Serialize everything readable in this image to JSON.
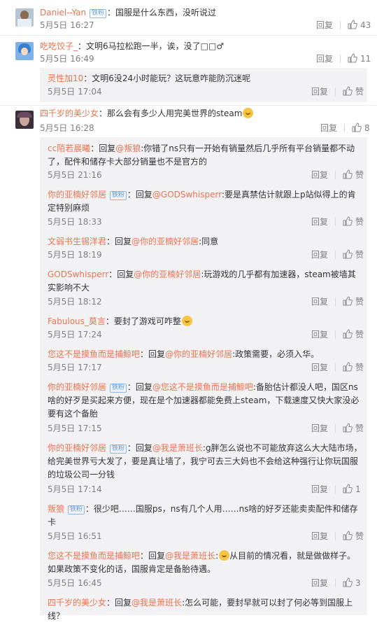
{
  "labels": {
    "reply": "回复",
    "like": "赞",
    "reply_prefix": "回复"
  },
  "top_comments": [
    {
      "user": "Daniel--Yan",
      "badge": "铁粉",
      "text": "：国服是什么东西，没听说过",
      "date": "5月5日 16:27",
      "likes": "43"
    },
    {
      "user": "吃吃饺子_",
      "text": "：文明6马拉松跑一半，诶，没了□□♂",
      "date": "5月5日 16:49",
      "likes": "11"
    },
    {
      "user": "四千岁的美少女",
      "text": "：那么会有多少人用完美世界的steam",
      "date": "5月5日 16:28",
      "likes": "8"
    }
  ],
  "sub_replies": [
    {
      "user": "灵性加10",
      "text": "：文明6没24小时能玩？这玩意咋能防沉迷呢",
      "date": "5月5日 17:04"
    },
    {
      "user": "cc陌若晨曦",
      "mention": "@叛狼",
      "text": ":你错了ns只有一开始有销量然后几乎所有平台销量都不动了，配件和储存卡大部分销量也不是官方的",
      "date": "5月5日 21:16"
    },
    {
      "user": "你的亚楠好邻居",
      "badge": "铁粉",
      "mention": "@GODSwhisperr",
      "text": ":要是真禁估计就跟上p站似得上的肯定特别麻烦",
      "date": "5月5日 18:33"
    },
    {
      "user": "文弱书生锡洋君",
      "mention": "@你的亚楠好邻居",
      "text": ":同意",
      "date": "5月5日 18:19"
    },
    {
      "user": "GODSwhisperr",
      "mention": "@你的亚楠好邻居",
      "text": ":玩游戏的几乎都有加速器，steam被墙其实影响不大",
      "date": "5月5日 18:12"
    },
    {
      "user": "Fabulous_莫言",
      "text": "：要封了游戏可咋整",
      "date": "5月5日 17:24"
    },
    {
      "user": "您这不是摸鱼而是捕鲸吧",
      "mention": "@你的亚楠好邻居",
      "text": ":政策需要，必须入华。",
      "date": "5月5日 17:17"
    },
    {
      "user": "你的亚楠好邻居",
      "badge": "铁粉",
      "mention": "@您这不是摸鱼而是捕鲸吧",
      "text": ":备胎估计都没人吧，国区ns啥的好歹是买起来方便，现在是个加速器都能免费上steam，下载速度又快大家没必要有这个备胎",
      "date": "5月5日 17:15"
    },
    {
      "user": "你的亚楠好邻居",
      "badge": "铁粉",
      "mention": "@我是萧班长",
      "text": ":g胖怎么说也不可能放弃这么大大陆市场，给完美世界亏大发了，要是真让墙了，我宁可去三大妈也不会给这种强行让你玩国服的垃圾公司一分钱",
      "date": "5月5日 17:14",
      "likes": "1"
    },
    {
      "user": "叛狼",
      "badge": "铁粉",
      "text": "：很少吧……国服ps，ns有几个人用……ns啥的好歹还能卖卖配件和储存卡",
      "date": "5月5日 16:51"
    },
    {
      "user": "您这不是摸鱼而是捕鲸吧",
      "mention": "@我是萧班长",
      "text": "从目前的情况看，就是做做样子。如果政策不变化的话，国服肯定是备胎待遇。",
      "date": "5月5日 16:45",
      "likes": "3"
    },
    {
      "user": "四千岁的美少女",
      "mention": "@我是萧班长",
      "text": ":怎么可能，要封早就可以封了何必等到国服上线？",
      "date": ""
    }
  ]
}
